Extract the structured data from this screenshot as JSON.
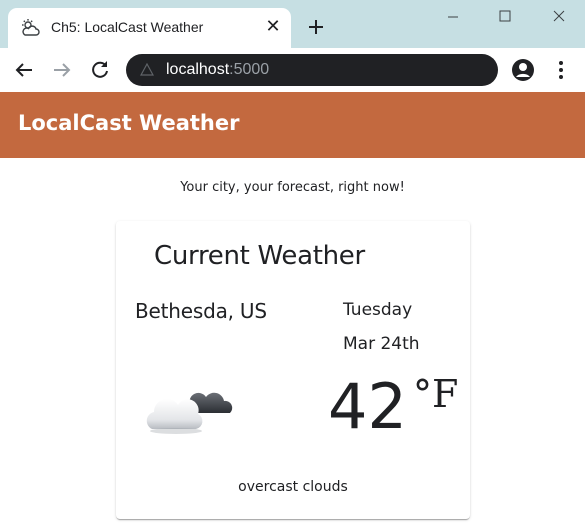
{
  "browser": {
    "tab": {
      "title": "Ch5: LocalCast Weather",
      "icon": "weather-app-icon",
      "close_icon": "close-icon"
    },
    "new_tab_icon": "plus-icon",
    "window_controls": [
      "minimize-icon",
      "maximize-icon",
      "close-icon"
    ],
    "address_bar": {
      "host": "localhost",
      "port": ":5000"
    },
    "nav_icons": [
      "back-arrow-icon",
      "forward-arrow-icon",
      "reload-icon",
      "info-icon",
      "profile-icon",
      "more-vert-icon"
    ]
  },
  "app": {
    "title": "LocalCast Weather",
    "header_color": "#c3693f",
    "tagline": "Your city, your forecast, right now!",
    "card": {
      "title": "Current Weather",
      "city": "Bethesda, US",
      "day": "Tuesday",
      "date": "Mar 24th",
      "temperature": "42",
      "unit": "°F",
      "description": "overcast clouds",
      "icon": "overcast-clouds-icon"
    }
  }
}
